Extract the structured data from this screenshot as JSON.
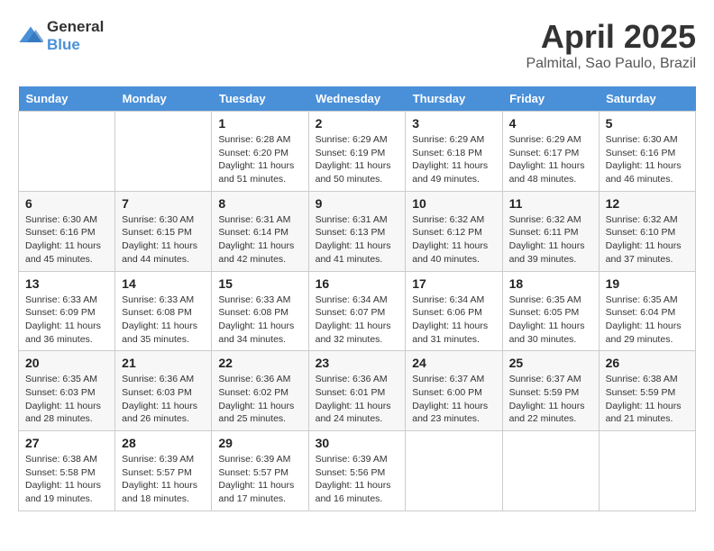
{
  "header": {
    "logo_line1": "General",
    "logo_line2": "Blue",
    "month": "April 2025",
    "location": "Palmital, Sao Paulo, Brazil"
  },
  "columns": [
    "Sunday",
    "Monday",
    "Tuesday",
    "Wednesday",
    "Thursday",
    "Friday",
    "Saturday"
  ],
  "weeks": [
    [
      {
        "day": "",
        "sunrise": "",
        "sunset": "",
        "daylight": ""
      },
      {
        "day": "",
        "sunrise": "",
        "sunset": "",
        "daylight": ""
      },
      {
        "day": "1",
        "sunrise": "Sunrise: 6:28 AM",
        "sunset": "Sunset: 6:20 PM",
        "daylight": "Daylight: 11 hours and 51 minutes."
      },
      {
        "day": "2",
        "sunrise": "Sunrise: 6:29 AM",
        "sunset": "Sunset: 6:19 PM",
        "daylight": "Daylight: 11 hours and 50 minutes."
      },
      {
        "day": "3",
        "sunrise": "Sunrise: 6:29 AM",
        "sunset": "Sunset: 6:18 PM",
        "daylight": "Daylight: 11 hours and 49 minutes."
      },
      {
        "day": "4",
        "sunrise": "Sunrise: 6:29 AM",
        "sunset": "Sunset: 6:17 PM",
        "daylight": "Daylight: 11 hours and 48 minutes."
      },
      {
        "day": "5",
        "sunrise": "Sunrise: 6:30 AM",
        "sunset": "Sunset: 6:16 PM",
        "daylight": "Daylight: 11 hours and 46 minutes."
      }
    ],
    [
      {
        "day": "6",
        "sunrise": "Sunrise: 6:30 AM",
        "sunset": "Sunset: 6:16 PM",
        "daylight": "Daylight: 11 hours and 45 minutes."
      },
      {
        "day": "7",
        "sunrise": "Sunrise: 6:30 AM",
        "sunset": "Sunset: 6:15 PM",
        "daylight": "Daylight: 11 hours and 44 minutes."
      },
      {
        "day": "8",
        "sunrise": "Sunrise: 6:31 AM",
        "sunset": "Sunset: 6:14 PM",
        "daylight": "Daylight: 11 hours and 42 minutes."
      },
      {
        "day": "9",
        "sunrise": "Sunrise: 6:31 AM",
        "sunset": "Sunset: 6:13 PM",
        "daylight": "Daylight: 11 hours and 41 minutes."
      },
      {
        "day": "10",
        "sunrise": "Sunrise: 6:32 AM",
        "sunset": "Sunset: 6:12 PM",
        "daylight": "Daylight: 11 hours and 40 minutes."
      },
      {
        "day": "11",
        "sunrise": "Sunrise: 6:32 AM",
        "sunset": "Sunset: 6:11 PM",
        "daylight": "Daylight: 11 hours and 39 minutes."
      },
      {
        "day": "12",
        "sunrise": "Sunrise: 6:32 AM",
        "sunset": "Sunset: 6:10 PM",
        "daylight": "Daylight: 11 hours and 37 minutes."
      }
    ],
    [
      {
        "day": "13",
        "sunrise": "Sunrise: 6:33 AM",
        "sunset": "Sunset: 6:09 PM",
        "daylight": "Daylight: 11 hours and 36 minutes."
      },
      {
        "day": "14",
        "sunrise": "Sunrise: 6:33 AM",
        "sunset": "Sunset: 6:08 PM",
        "daylight": "Daylight: 11 hours and 35 minutes."
      },
      {
        "day": "15",
        "sunrise": "Sunrise: 6:33 AM",
        "sunset": "Sunset: 6:08 PM",
        "daylight": "Daylight: 11 hours and 34 minutes."
      },
      {
        "day": "16",
        "sunrise": "Sunrise: 6:34 AM",
        "sunset": "Sunset: 6:07 PM",
        "daylight": "Daylight: 11 hours and 32 minutes."
      },
      {
        "day": "17",
        "sunrise": "Sunrise: 6:34 AM",
        "sunset": "Sunset: 6:06 PM",
        "daylight": "Daylight: 11 hours and 31 minutes."
      },
      {
        "day": "18",
        "sunrise": "Sunrise: 6:35 AM",
        "sunset": "Sunset: 6:05 PM",
        "daylight": "Daylight: 11 hours and 30 minutes."
      },
      {
        "day": "19",
        "sunrise": "Sunrise: 6:35 AM",
        "sunset": "Sunset: 6:04 PM",
        "daylight": "Daylight: 11 hours and 29 minutes."
      }
    ],
    [
      {
        "day": "20",
        "sunrise": "Sunrise: 6:35 AM",
        "sunset": "Sunset: 6:03 PM",
        "daylight": "Daylight: 11 hours and 28 minutes."
      },
      {
        "day": "21",
        "sunrise": "Sunrise: 6:36 AM",
        "sunset": "Sunset: 6:03 PM",
        "daylight": "Daylight: 11 hours and 26 minutes."
      },
      {
        "day": "22",
        "sunrise": "Sunrise: 6:36 AM",
        "sunset": "Sunset: 6:02 PM",
        "daylight": "Daylight: 11 hours and 25 minutes."
      },
      {
        "day": "23",
        "sunrise": "Sunrise: 6:36 AM",
        "sunset": "Sunset: 6:01 PM",
        "daylight": "Daylight: 11 hours and 24 minutes."
      },
      {
        "day": "24",
        "sunrise": "Sunrise: 6:37 AM",
        "sunset": "Sunset: 6:00 PM",
        "daylight": "Daylight: 11 hours and 23 minutes."
      },
      {
        "day": "25",
        "sunrise": "Sunrise: 6:37 AM",
        "sunset": "Sunset: 5:59 PM",
        "daylight": "Daylight: 11 hours and 22 minutes."
      },
      {
        "day": "26",
        "sunrise": "Sunrise: 6:38 AM",
        "sunset": "Sunset: 5:59 PM",
        "daylight": "Daylight: 11 hours and 21 minutes."
      }
    ],
    [
      {
        "day": "27",
        "sunrise": "Sunrise: 6:38 AM",
        "sunset": "Sunset: 5:58 PM",
        "daylight": "Daylight: 11 hours and 19 minutes."
      },
      {
        "day": "28",
        "sunrise": "Sunrise: 6:39 AM",
        "sunset": "Sunset: 5:57 PM",
        "daylight": "Daylight: 11 hours and 18 minutes."
      },
      {
        "day": "29",
        "sunrise": "Sunrise: 6:39 AM",
        "sunset": "Sunset: 5:57 PM",
        "daylight": "Daylight: 11 hours and 17 minutes."
      },
      {
        "day": "30",
        "sunrise": "Sunrise: 6:39 AM",
        "sunset": "Sunset: 5:56 PM",
        "daylight": "Daylight: 11 hours and 16 minutes."
      },
      {
        "day": "",
        "sunrise": "",
        "sunset": "",
        "daylight": ""
      },
      {
        "day": "",
        "sunrise": "",
        "sunset": "",
        "daylight": ""
      },
      {
        "day": "",
        "sunrise": "",
        "sunset": "",
        "daylight": ""
      }
    ]
  ]
}
